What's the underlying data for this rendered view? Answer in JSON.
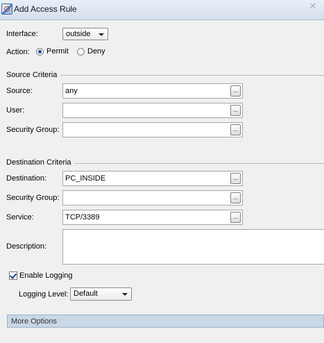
{
  "window": {
    "title": "Add Access Rule"
  },
  "form": {
    "interface": {
      "label": "Interface:",
      "value": "outside"
    },
    "action": {
      "label": "Action:",
      "options": [
        {
          "label": "Permit",
          "selected": true
        },
        {
          "label": "Deny",
          "selected": false
        }
      ]
    }
  },
  "source_criteria": {
    "heading": "Source Criteria",
    "source": {
      "label": "Source:",
      "value": "any"
    },
    "user": {
      "label": "User:",
      "value": ""
    },
    "security_group": {
      "label": "Security Group:",
      "value": ""
    }
  },
  "destination_criteria": {
    "heading": "Destination Criteria",
    "destination": {
      "label": "Destination:",
      "value": "PC_INSIDE"
    },
    "security_group": {
      "label": "Security Group:",
      "value": ""
    },
    "service": {
      "label": "Service:",
      "value": "TCP/3389"
    }
  },
  "description": {
    "label": "Description:",
    "value": ""
  },
  "logging": {
    "enable_label": "Enable Logging",
    "enabled": true,
    "level_label": "Logging Level:",
    "level_value": "Default"
  },
  "more_options": {
    "label": "More Options"
  },
  "browse_button_label": "..."
}
